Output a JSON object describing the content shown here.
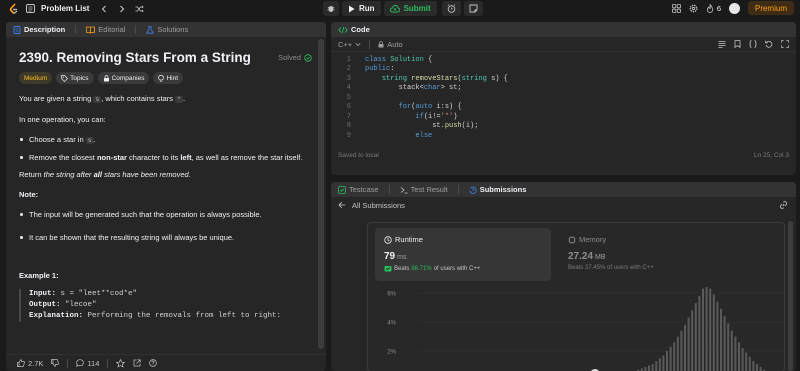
{
  "topbar": {
    "problem_list": "Problem List",
    "run": "Run",
    "submit": "Submit",
    "streak": "6",
    "premium": "Premium"
  },
  "description_panel": {
    "tabs": [
      {
        "label": "Description",
        "active": true
      },
      {
        "label": "Editorial",
        "active": false
      },
      {
        "label": "Solutions",
        "active": false
      }
    ],
    "title": "2390. Removing Stars From a String",
    "solved": "Solved",
    "tags": [
      "Medium",
      "Topics",
      "Companies",
      "Hint"
    ],
    "intro_before": "You are given a string ",
    "intro_s": "s",
    "intro_mid": ", which contains stars ",
    "intro_star": "*",
    "intro_end": ".",
    "op_text": "In one operation, you can:",
    "bullet1_before": "Choose a star in ",
    "bullet1_s": "s",
    "bullet1_end": ".",
    "bullet2_before": "Remove the closest ",
    "bullet2_bold1": "non-star",
    "bullet2_mid": " character to its ",
    "bullet2_bold2": "left",
    "bullet2_end": ", as well as remove the star itself.",
    "return_before": "Return ",
    "return_italic1": "the string after ",
    "return_bold": "all",
    "return_italic2": " stars have been removed",
    "return_end": ".",
    "note": "Note:",
    "note1": "The input will be generated such that the operation is always possible.",
    "note2": "It can be shown that the resulting string will always be unique.",
    "example_title": "Example 1:",
    "ex_input_label": "Input:",
    "ex_input_value": " s = \"leet**cod*e\"",
    "ex_output_label": "Output:",
    "ex_output_value": " \"lecoe\"",
    "ex_expl_label": "Explanation:",
    "ex_expl_value": " Performing the removals from left to right:",
    "likes": "2.7K",
    "comments": "114"
  },
  "code_panel": {
    "title": "Code",
    "language": "C++",
    "mode": "Auto",
    "lines": [
      {
        "n": "1",
        "parts": [
          [
            "kw",
            "class "
          ],
          [
            "ty",
            "Solution"
          ],
          [
            "txt",
            " {"
          ]
        ]
      },
      {
        "n": "2",
        "parts": [
          [
            "kw",
            "public"
          ],
          [
            "txt",
            ":"
          ]
        ]
      },
      {
        "n": "3",
        "parts": [
          [
            "txt",
            "    "
          ],
          [
            "ty",
            "string"
          ],
          [
            "txt",
            " "
          ],
          [
            "fn",
            "removeStars"
          ],
          [
            "txt",
            "("
          ],
          [
            "ty",
            "string"
          ],
          [
            "txt",
            " s) {"
          ]
        ]
      },
      {
        "n": "4",
        "parts": [
          [
            "txt",
            "        stack<"
          ],
          [
            "kw",
            "char"
          ],
          [
            "txt",
            "> st;"
          ]
        ]
      },
      {
        "n": "5",
        "parts": [
          [
            "txt",
            ""
          ]
        ]
      },
      {
        "n": "6",
        "parts": [
          [
            "txt",
            "        "
          ],
          [
            "kw",
            "for"
          ],
          [
            "txt",
            "("
          ],
          [
            "kw",
            "auto"
          ],
          [
            "txt",
            " i:s) {"
          ]
        ]
      },
      {
        "n": "7",
        "parts": [
          [
            "txt",
            "            "
          ],
          [
            "kw",
            "if"
          ],
          [
            "txt",
            "(i!="
          ],
          [
            "str",
            "'*'"
          ],
          [
            "txt",
            ")"
          ]
        ]
      },
      {
        "n": "8",
        "parts": [
          [
            "txt",
            "                st."
          ],
          [
            "fn",
            "push"
          ],
          [
            "txt",
            "(i);"
          ]
        ]
      },
      {
        "n": "9",
        "parts": [
          [
            "txt",
            "            "
          ],
          [
            "kw",
            "else"
          ]
        ]
      }
    ],
    "saved": "Saved to local",
    "cursor": "Ln 25, Col 3"
  },
  "result_panel": {
    "tabs": [
      {
        "label": "Testcase",
        "active": false
      },
      {
        "label": "Test Result",
        "active": false
      },
      {
        "label": "Submissions",
        "active": true
      }
    ],
    "all_submissions": "All Submissions",
    "runtime": {
      "label": "Runtime",
      "value": "79",
      "unit": "ms",
      "beats_label": "Beats",
      "beats_value": "88.71%",
      "beats_suffix": "of users with C++"
    },
    "memory": {
      "label": "Memory",
      "value": "27.24",
      "unit": "MB",
      "beats_text": "Beats 37.45% of users with C++"
    }
  },
  "chart_data": {
    "type": "bar",
    "yticks": [
      "6%",
      "4%",
      "2%"
    ],
    "ylim": [
      0,
      7
    ],
    "values": [
      0.1,
      0.1,
      0.1,
      0.2,
      0.2,
      0.3,
      0.3,
      0.4,
      0.4,
      0.5,
      0.5,
      0.6,
      0.7,
      0.8,
      0.9,
      1.0,
      1.1,
      1.3,
      1.5,
      1.7,
      2.0,
      2.3,
      2.6,
      3.0,
      3.4,
      3.8,
      4.3,
      4.8,
      5.3,
      5.8,
      6.3,
      6.9,
      6.3,
      5.9,
      5.4,
      4.9,
      4.4,
      3.9,
      3.4,
      3.0,
      2.6,
      2.2,
      1.9,
      1.6,
      1.3,
      1.1,
      0.9,
      0.7,
      0.6,
      0.5,
      0.4,
      0.3,
      0.3,
      0.2,
      0.2,
      0.1
    ],
    "highlight_index": 0
  }
}
